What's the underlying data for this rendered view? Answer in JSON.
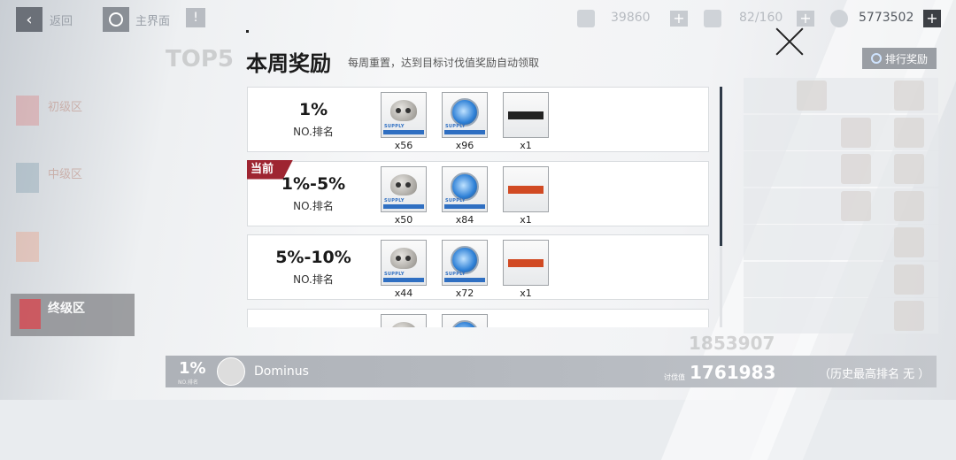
{
  "topbar": {
    "back_label": "返回",
    "home_label": "主界面",
    "resource1": "39860",
    "resource2": "82/160",
    "coins": "5773502"
  },
  "left_zones": [
    "初级区",
    "中级区",
    "终级区"
  ],
  "ghost": {
    "title": "TOP5",
    "score": "1853907"
  },
  "modal": {
    "title": "本周奖励",
    "subtitle": "每周重置，达到目标讨伐值奖励自动领取",
    "rank_reward_label": "排行奖励",
    "current_badge": "当前",
    "rank_sub": "NO.排名",
    "tiers": [
      {
        "rank": "1%",
        "items": [
          {
            "type": "skull",
            "count": "x56"
          },
          {
            "type": "coin",
            "count": "x96"
          },
          {
            "type": "tag",
            "count": "x1"
          }
        ]
      },
      {
        "rank": "1%-5%",
        "current": true,
        "items": [
          {
            "type": "skull",
            "count": "x50"
          },
          {
            "type": "coin",
            "count": "x84"
          },
          {
            "type": "tag",
            "count": "x1"
          }
        ]
      },
      {
        "rank": "5%-10%",
        "items": [
          {
            "type": "skull",
            "count": "x44"
          },
          {
            "type": "coin",
            "count": "x72"
          },
          {
            "type": "tag",
            "count": "x1"
          }
        ]
      }
    ]
  },
  "bottom": {
    "rank": "1%",
    "rank_sub": "NO.排名",
    "name": "Dominus",
    "score_label": "讨伐值",
    "score": "1761983",
    "history": "（历史最高排名  无  ）"
  }
}
